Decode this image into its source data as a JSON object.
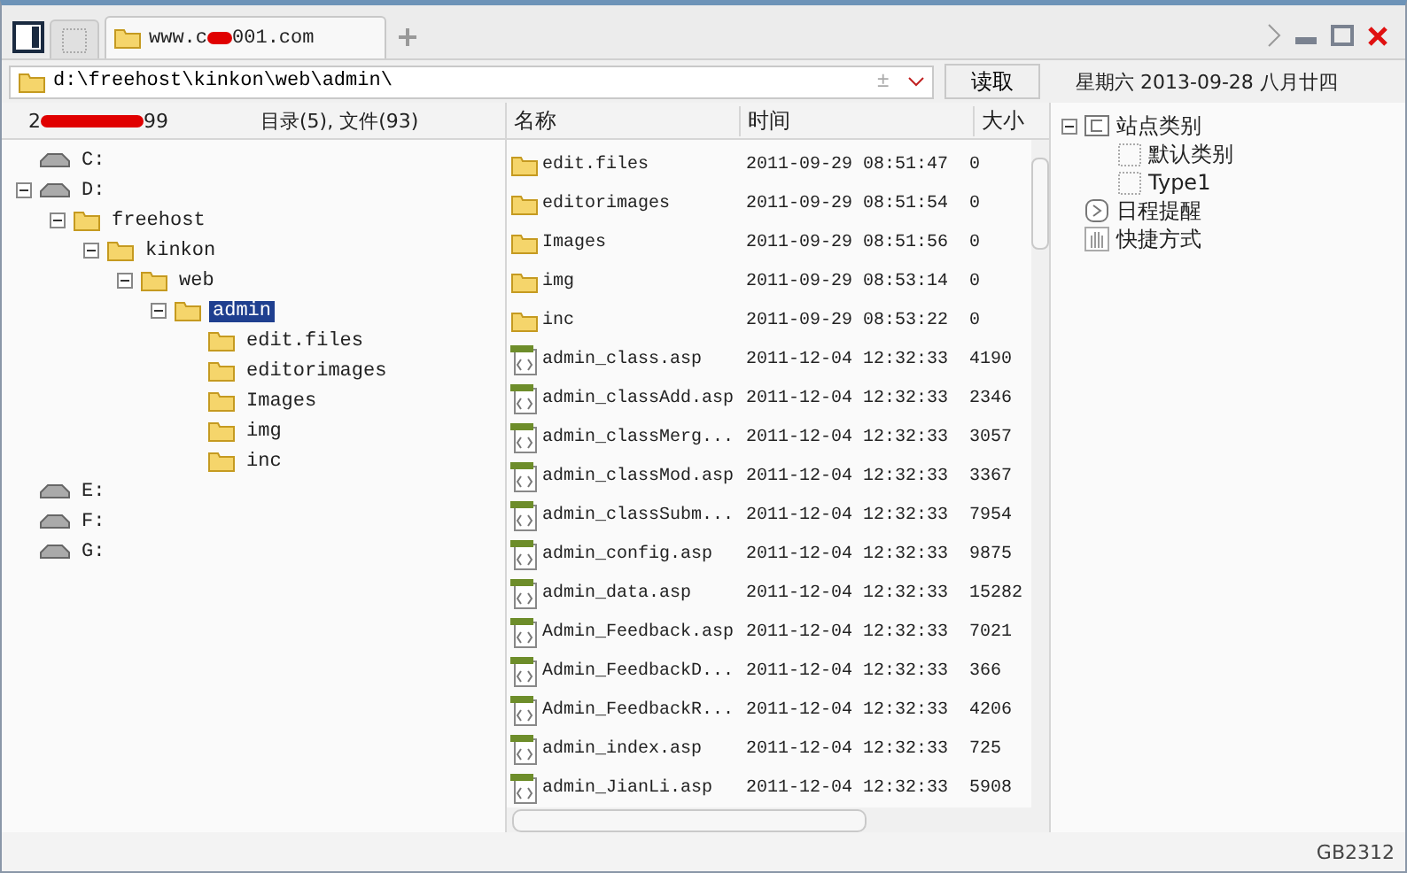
{
  "tabs": [
    {
      "kind": "blank",
      "selected": false
    },
    {
      "kind": "folder",
      "title_start": "www.c",
      "title_end": "001.com",
      "selected": true
    }
  ],
  "address": {
    "value": "d:\\freehost\\kinkon\\web\\admin\\",
    "plusminus": "±",
    "read_button": "读取"
  },
  "date": "星期六 2013-09-28 八月廿四",
  "left_header": {
    "id_start": "2",
    "id_end": "99",
    "summary": "目录(5), 文件(93)"
  },
  "tree": [
    {
      "label": "C:",
      "kind": "drive",
      "selected": false
    },
    {
      "label": "D:",
      "kind": "drive",
      "expanded": true,
      "selected": false,
      "children": [
        {
          "label": "freehost",
          "kind": "folder",
          "expanded": true,
          "selected": false,
          "children": [
            {
              "label": "kinkon",
              "kind": "folder",
              "expanded": true,
              "selected": false,
              "children": [
                {
                  "label": "web",
                  "kind": "folder",
                  "expanded": true,
                  "selected": false,
                  "children": [
                    {
                      "label": "admin",
                      "kind": "folder",
                      "expanded": true,
                      "selected": true,
                      "children": [
                        {
                          "label": "edit.files",
                          "kind": "folder",
                          "selected": false
                        },
                        {
                          "label": "editorimages",
                          "kind": "folder",
                          "selected": false
                        },
                        {
                          "label": "Images",
                          "kind": "folder",
                          "selected": false
                        },
                        {
                          "label": "img",
                          "kind": "folder",
                          "selected": false
                        },
                        {
                          "label": "inc",
                          "kind": "folder",
                          "selected": false
                        }
                      ]
                    }
                  ]
                }
              ]
            }
          ]
        }
      ]
    },
    {
      "label": "E:",
      "kind": "drive",
      "selected": false
    },
    {
      "label": "F:",
      "kind": "drive",
      "selected": false
    },
    {
      "label": "G:",
      "kind": "drive",
      "selected": false
    }
  ],
  "columns": [
    "名称",
    "时间",
    "大小"
  ],
  "files": [
    {
      "kind": "folder",
      "name": "edit.files",
      "time": "2011-09-29 08:51:47",
      "size": "0"
    },
    {
      "kind": "folder",
      "name": "editorimages",
      "time": "2011-09-29 08:51:54",
      "size": "0"
    },
    {
      "kind": "folder",
      "name": "Images",
      "time": "2011-09-29 08:51:56",
      "size": "0"
    },
    {
      "kind": "folder",
      "name": "img",
      "time": "2011-09-29 08:53:14",
      "size": "0"
    },
    {
      "kind": "folder",
      "name": "inc",
      "time": "2011-09-29 08:53:22",
      "size": "0"
    },
    {
      "kind": "script",
      "name": "admin_class.asp",
      "time": "2011-12-04 12:32:33",
      "size": "4190"
    },
    {
      "kind": "script",
      "name": "admin_classAdd.asp",
      "time": "2011-12-04 12:32:33",
      "size": "2346"
    },
    {
      "kind": "script",
      "name": "admin_classMerg...",
      "time": "2011-12-04 12:32:33",
      "size": "3057"
    },
    {
      "kind": "script",
      "name": "admin_classMod.asp",
      "time": "2011-12-04 12:32:33",
      "size": "3367"
    },
    {
      "kind": "script",
      "name": "admin_classSubm...",
      "time": "2011-12-04 12:32:33",
      "size": "7954"
    },
    {
      "kind": "script",
      "name": "admin_config.asp",
      "time": "2011-12-04 12:32:33",
      "size": "9875"
    },
    {
      "kind": "script",
      "name": "admin_data.asp",
      "time": "2011-12-04 12:32:33",
      "size": "15282"
    },
    {
      "kind": "script",
      "name": "Admin_Feedback.asp",
      "time": "2011-12-04 12:32:33",
      "size": "7021"
    },
    {
      "kind": "script",
      "name": "Admin_FeedbackD...",
      "time": "2011-12-04 12:32:33",
      "size": "366"
    },
    {
      "kind": "script",
      "name": "Admin_FeedbackR...",
      "time": "2011-12-04 12:32:33",
      "size": "4206"
    },
    {
      "kind": "script",
      "name": "admin_index.asp",
      "time": "2011-12-04 12:32:33",
      "size": "725"
    },
    {
      "kind": "script",
      "name": "admin_JianLi.asp",
      "time": "2011-12-04 12:32:33",
      "size": "5908"
    }
  ],
  "side_tree": [
    {
      "label": "站点类别",
      "kind": "category",
      "expanded": true,
      "children": [
        {
          "label": "默认类别",
          "kind": "item"
        },
        {
          "label": "Type1",
          "kind": "item"
        }
      ]
    },
    {
      "label": "日程提醒",
      "kind": "schedule"
    },
    {
      "label": "快捷方式",
      "kind": "shortcut"
    }
  ],
  "status": "GB2312"
}
